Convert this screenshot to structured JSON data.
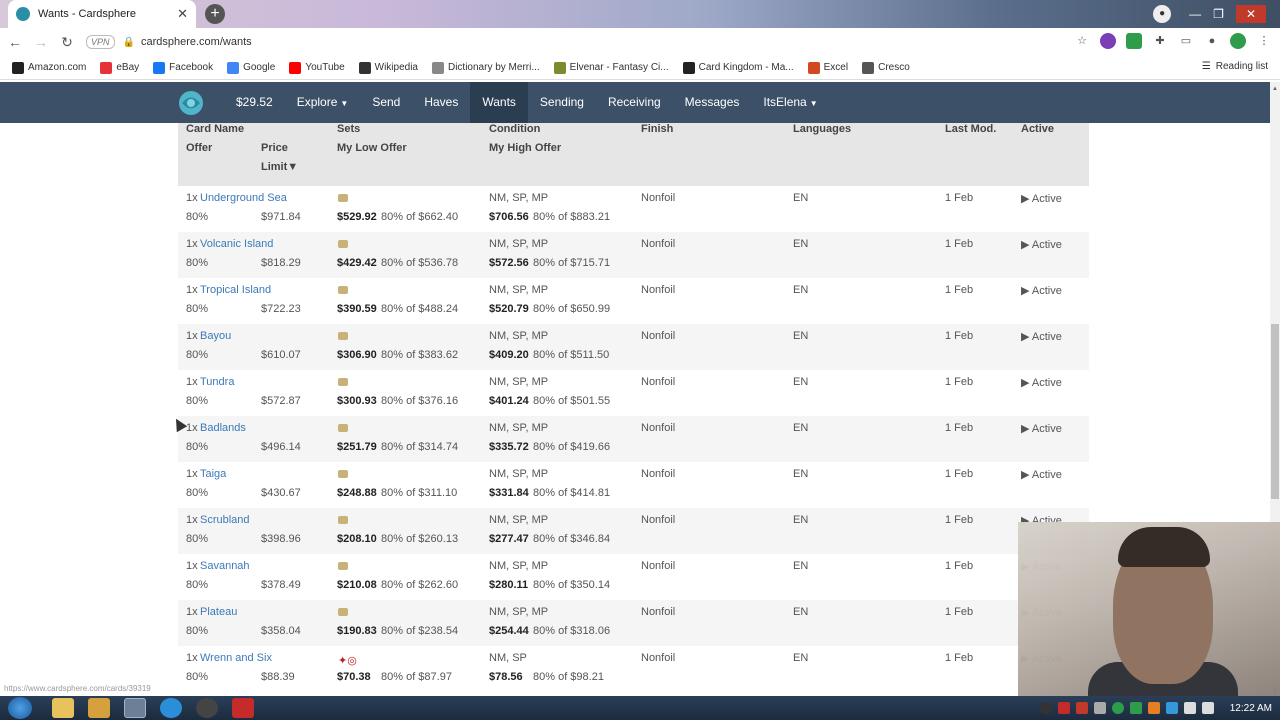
{
  "browser": {
    "tab_title": "Wants - Cardsphere",
    "tab_close": "✕",
    "new_tab": "+",
    "url": "cardsphere.com/wants",
    "vpn_label": "VPN",
    "window_minimize": "—",
    "window_maximize": "❐",
    "window_close": "✕",
    "bookmarks": [
      {
        "label": "Amazon.com",
        "color": "#222222"
      },
      {
        "label": "eBay",
        "color": "#e53238"
      },
      {
        "label": "Facebook",
        "color": "#1877f2"
      },
      {
        "label": "Google",
        "color": "#4285f4"
      },
      {
        "label": "YouTube",
        "color": "#ff0000"
      },
      {
        "label": "Wikipedia",
        "color": "#333333"
      },
      {
        "label": "Dictionary by Merri...",
        "color": "#888888"
      },
      {
        "label": "Elvenar - Fantasy Ci...",
        "color": "#7a8c2c"
      },
      {
        "label": "Card Kingdom - Ma...",
        "color": "#222222"
      },
      {
        "label": "Excel",
        "color": "#d04a1e"
      },
      {
        "label": "Cresco",
        "color": "#555555"
      }
    ],
    "reading_list": "Reading list",
    "status_url": "https://www.cardsphere.com/cards/39319"
  },
  "nav": {
    "balance": "$29.52",
    "items": [
      "Explore",
      "Send",
      "Haves",
      "Wants",
      "Sending",
      "Receiving",
      "Messages",
      "ItsElena"
    ],
    "active": "Wants"
  },
  "table": {
    "headers": {
      "card_name": "Card Name",
      "offer": "Offer",
      "price": "Price",
      "limit": "Limit▼",
      "sets": "Sets",
      "my_low_offer": "My Low Offer",
      "condition": "Condition",
      "my_high_offer": "My High Offer",
      "finish": "Finish",
      "languages": "Languages",
      "last_mod": "Last Mod.",
      "active": "Active"
    },
    "rows": [
      {
        "qty": "1x",
        "name": "Underground Sea",
        "offer": "80%",
        "limit": "$971.84",
        "low": "$529.92",
        "low_of": "80% of $662.40",
        "cond": "NM, SP, MP",
        "high": "$706.56",
        "high_of": "80% of $883.21",
        "finish": "Nonfoil",
        "lang": "EN",
        "mod": "1 Feb",
        "active": "▶ Active"
      },
      {
        "qty": "1x",
        "name": "Volcanic Island",
        "offer": "80%",
        "limit": "$818.29",
        "low": "$429.42",
        "low_of": "80% of $536.78",
        "cond": "NM, SP, MP",
        "high": "$572.56",
        "high_of": "80% of $715.71",
        "finish": "Nonfoil",
        "lang": "EN",
        "mod": "1 Feb",
        "active": "▶ Active"
      },
      {
        "qty": "1x",
        "name": "Tropical Island",
        "offer": "80%",
        "limit": "$722.23",
        "low": "$390.59",
        "low_of": "80% of $488.24",
        "cond": "NM, SP, MP",
        "high": "$520.79",
        "high_of": "80% of $650.99",
        "finish": "Nonfoil",
        "lang": "EN",
        "mod": "1 Feb",
        "active": "▶ Active"
      },
      {
        "qty": "1x",
        "name": "Bayou",
        "offer": "80%",
        "limit": "$610.07",
        "low": "$306.90",
        "low_of": "80% of $383.62",
        "cond": "NM, SP, MP",
        "high": "$409.20",
        "high_of": "80% of $511.50",
        "finish": "Nonfoil",
        "lang": "EN",
        "mod": "1 Feb",
        "active": "▶ Active"
      },
      {
        "qty": "1x",
        "name": "Tundra",
        "offer": "80%",
        "limit": "$572.87",
        "low": "$300.93",
        "low_of": "80% of $376.16",
        "cond": "NM, SP, MP",
        "high": "$401.24",
        "high_of": "80% of $501.55",
        "finish": "Nonfoil",
        "lang": "EN",
        "mod": "1 Feb",
        "active": "▶ Active"
      },
      {
        "qty": "1x",
        "name": "Badlands",
        "offer": "80%",
        "limit": "$496.14",
        "low": "$251.79",
        "low_of": "80% of $314.74",
        "cond": "NM, SP, MP",
        "high": "$335.72",
        "high_of": "80% of $419.66",
        "finish": "Nonfoil",
        "lang": "EN",
        "mod": "1 Feb",
        "active": "▶ Active"
      },
      {
        "qty": "1x",
        "name": "Taiga",
        "offer": "80%",
        "limit": "$430.67",
        "low": "$248.88",
        "low_of": "80% of $311.10",
        "cond": "NM, SP, MP",
        "high": "$331.84",
        "high_of": "80% of $414.81",
        "finish": "Nonfoil",
        "lang": "EN",
        "mod": "1 Feb",
        "active": "▶ Active"
      },
      {
        "qty": "1x",
        "name": "Scrubland",
        "offer": "80%",
        "limit": "$398.96",
        "low": "$208.10",
        "low_of": "80% of $260.13",
        "cond": "NM, SP, MP",
        "high": "$277.47",
        "high_of": "80% of $346.84",
        "finish": "Nonfoil",
        "lang": "EN",
        "mod": "1 Feb",
        "active": "▶ Active"
      },
      {
        "qty": "1x",
        "name": "Savannah",
        "offer": "80%",
        "limit": "$378.49",
        "low": "$210.08",
        "low_of": "80% of $262.60",
        "cond": "NM, SP, MP",
        "high": "$280.11",
        "high_of": "80% of $350.14",
        "finish": "Nonfoil",
        "lang": "EN",
        "mod": "1 Feb",
        "active": "▶ Active"
      },
      {
        "qty": "1x",
        "name": "Plateau",
        "offer": "80%",
        "limit": "$358.04",
        "low": "$190.83",
        "low_of": "80% of $238.54",
        "cond": "NM, SP, MP",
        "high": "$254.44",
        "high_of": "80% of $318.06",
        "finish": "Nonfoil",
        "lang": "EN",
        "mod": "1 Feb",
        "active": "▶ Active"
      },
      {
        "qty": "1x",
        "name": "Wrenn and Six",
        "offer": "80%",
        "limit": "$88.39",
        "low": "$70.38",
        "low_of": "80% of $87.97",
        "cond": "NM, SP",
        "high": "$78.56",
        "high_of": "80% of $98.21",
        "finish": "Nonfoil",
        "lang": "EN",
        "mod": "1 Feb",
        "active": "▶ Active"
      }
    ]
  },
  "taskbar": {
    "time": "12:22 AM"
  }
}
